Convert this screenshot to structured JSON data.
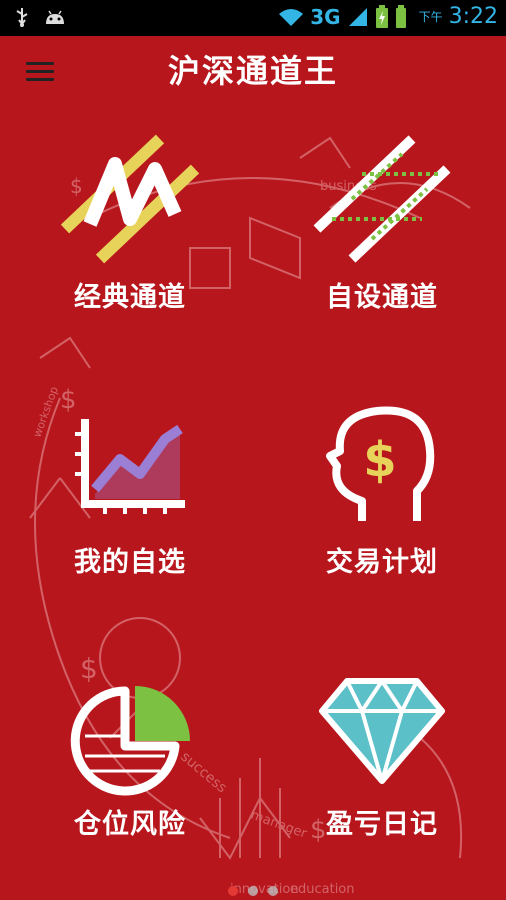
{
  "status_bar": {
    "network": "3G",
    "ampm": "下午",
    "time": "3:22"
  },
  "app": {
    "title": "沪深通道王"
  },
  "tiles": [
    {
      "label": "经典通道"
    },
    {
      "label": "自设通道"
    },
    {
      "label": "我的自选"
    },
    {
      "label": "交易计划"
    },
    {
      "label": "仓位风险"
    },
    {
      "label": "盈亏日记"
    }
  ],
  "page_indicator": {
    "pages": 3,
    "active_index": 0
  },
  "colors": {
    "background": "#b8161d",
    "status_accent": "#33b5e5",
    "yellow": "#e8d35a",
    "green": "#7cc142",
    "purple": "#9b7fd4",
    "diamond": "#5bc0c8"
  }
}
